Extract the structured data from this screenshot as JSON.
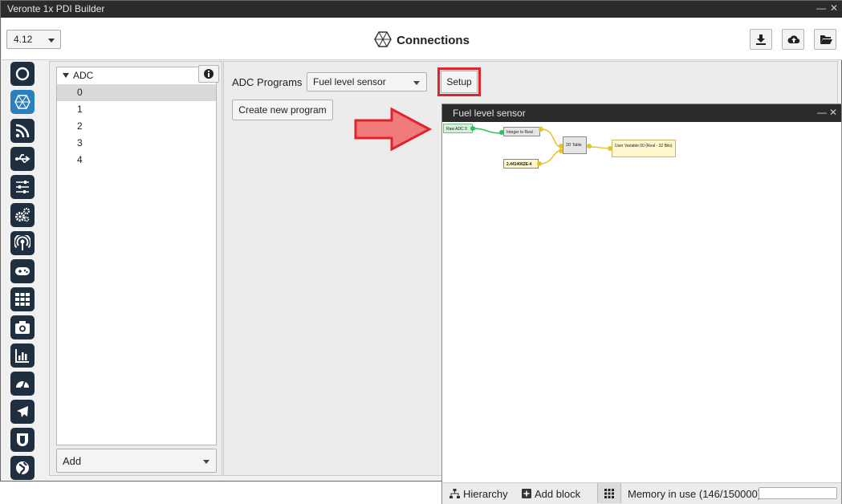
{
  "window": {
    "title": "Veronte 1x PDI Builder",
    "minimize": "—",
    "close": "✕"
  },
  "toolbar": {
    "version": "4.12",
    "page_title": "Connections",
    "buttons": [
      "download-icon",
      "cloud-upload-icon",
      "folder-open-icon"
    ]
  },
  "sidebar": {
    "icons": [
      "power-icon",
      "connections-icon",
      "rss-icon",
      "usb-icon",
      "sliders-icon",
      "gears-icon",
      "broadcast-icon",
      "gamepad-icon",
      "grid-icon",
      "camera-icon",
      "chart-icon",
      "gauge-icon",
      "airplane-icon",
      "shield-icon",
      "globe-icon"
    ],
    "active_index": 1
  },
  "tree": {
    "root": "ADC",
    "items": [
      "0",
      "1",
      "2",
      "3",
      "4"
    ],
    "selected": "0",
    "add_label": "Add"
  },
  "adc": {
    "programs_label": "ADC Programs",
    "selected_program": "Fuel level sensor",
    "setup_label": "Setup",
    "create_label": "Create new program"
  },
  "float_window": {
    "title": "Fuel level sensor",
    "blocks": {
      "raw": "Raw ADC 0",
      "int2real": "Integer to Real",
      "table": "2D Table",
      "constant": "2.4414062E-4",
      "uservar": "User Variable 00 (Real - 32 Bits)"
    },
    "status": {
      "hierarchy": "Hierarchy",
      "add_block": "Add block",
      "memory": "Memory in use (146/150000)"
    }
  },
  "colors": {
    "accent": "#2b7fbd",
    "highlight": "#e0242d",
    "arrow": "#f07b7b",
    "wire_green": "#2ec25c",
    "wire_yellow": "#e6c229"
  }
}
